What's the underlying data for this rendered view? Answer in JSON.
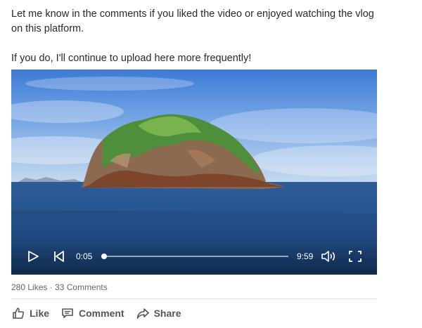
{
  "post": {
    "paragraphs": [
      "Let me know in the comments if you liked the video or enjoyed watching the vlog on this platform.",
      "If you do, I'll continue to upload here more frequently!"
    ]
  },
  "video": {
    "current_time": "0:05",
    "duration": "9:59",
    "progress_fraction": 0.0083,
    "controls": {
      "play_icon": "play-icon",
      "restart_icon": "skip-back-icon",
      "volume_icon": "volume-icon",
      "fullscreen_icon": "fullscreen-icon"
    }
  },
  "stats": {
    "likes": "280 Likes",
    "separator": " · ",
    "comments": "33 Comments"
  },
  "actions": {
    "like_label": "Like",
    "comment_label": "Comment",
    "share_label": "Share"
  }
}
